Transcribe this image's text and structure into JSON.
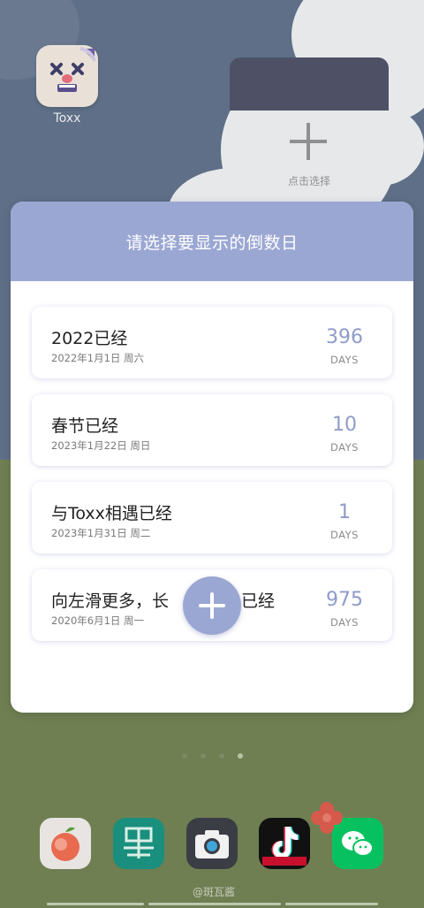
{
  "home": {
    "app_label": "Toxx",
    "widget_placeholder": "点击选择",
    "dock_watermark": "@斑瓦酱"
  },
  "modal": {
    "title": "请选择要显示的倒数日",
    "items": [
      {
        "title": "2022已经",
        "date": "2022年1月1日 周六",
        "count": "396",
        "unit": "DAYS"
      },
      {
        "title": "春节已经",
        "date": "2023年1月22日 周日",
        "count": "10",
        "unit": "DAYS"
      },
      {
        "title": "与Toxx相遇已经",
        "date": "2023年1月31日 周二",
        "count": "1",
        "unit": "DAYS"
      },
      {
        "title": "向左滑更多，长",
        "title_end": "已经",
        "date": "2020年6月1日 周一",
        "count": "975",
        "unit": "DAYS"
      }
    ]
  },
  "colors": {
    "accent": "#9ba7d3",
    "count": "#8f9bc9"
  },
  "dock": {
    "icons": [
      "peach-app-icon",
      "ink-app-icon",
      "camera-icon",
      "tiktok-icon",
      "wechat-icon"
    ]
  }
}
